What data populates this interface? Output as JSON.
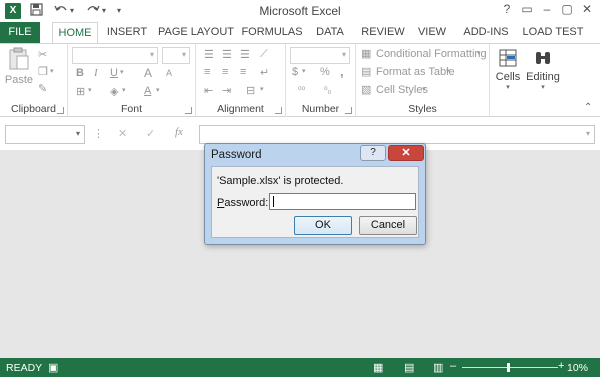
{
  "app": {
    "title": "Microsoft Excel",
    "icon_label": "X",
    "brand_color": "#217346"
  },
  "qat": {
    "save_icon": "save-icon",
    "undo_icon": "undo-icon",
    "redo_icon": "redo-icon"
  },
  "window_buttons": {
    "help": "?",
    "ribbon_display": "▭",
    "minimize": "–",
    "restore": "▢",
    "close": "✕"
  },
  "tabs": [
    "FILE",
    "HOME",
    "INSERT",
    "PAGE LAYOUT",
    "FORMULAS",
    "DATA",
    "REVIEW",
    "VIEW",
    "ADD-INS",
    "LOAD TEST"
  ],
  "ribbon": {
    "clipboard": {
      "label": "Clipboard",
      "paste": "Paste"
    },
    "font": {
      "label": "Font",
      "bold": "B",
      "italic": "I",
      "underline": "U",
      "grow": "A",
      "shrink": "A"
    },
    "alignment": {
      "label": "Alignment"
    },
    "number": {
      "label": "Number",
      "percent": "%",
      "comma": ","
    },
    "styles": {
      "label": "Styles",
      "conditional_formatting": "Conditional Formatting",
      "format_as_table": "Format as Table",
      "cell_styles": "Cell Styles"
    },
    "cells": {
      "label": "Cells"
    },
    "editing": {
      "label": "Editing"
    }
  },
  "formula_bar": {
    "cancel": "✕",
    "enter": "✓",
    "fx": "fx"
  },
  "dialog": {
    "title": "Password",
    "help": "?",
    "close": "✕",
    "message": "'Sample.xlsx' is protected.",
    "password_label_prefix": "P",
    "password_label_rest": "assword:",
    "password_value": "",
    "ok": "OK",
    "cancel": "Cancel"
  },
  "status": {
    "ready": "READY",
    "zoom": "10%",
    "zoom_fraction": 0.1
  }
}
